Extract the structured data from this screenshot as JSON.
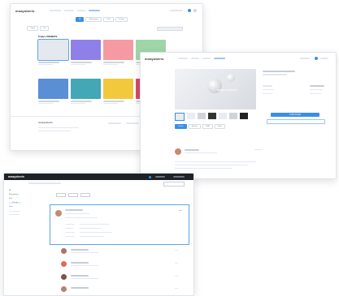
{
  "brand": {
    "logo": "moayoberis"
  },
  "win1": {
    "tabs": [
      "All",
      "Marketplace",
      "Kids",
      "Vintage"
    ],
    "filters": [
      "Latest",
      "List"
    ],
    "section_title": "Today's PROMOTE",
    "footer_logo": "moayoberis",
    "cards": [
      {
        "color": "#e4e9ef",
        "selected": true
      },
      {
        "color": "#8f7fe8"
      },
      {
        "color": "#f59aa2"
      },
      {
        "color": "#9ed6a8"
      },
      {
        "color": "#5a8fd6"
      },
      {
        "color": "#44a7b5"
      },
      {
        "color": "#f2c93c"
      },
      {
        "color": "#d44b6a"
      }
    ]
  },
  "win2": {
    "logo": "moayoberis",
    "product_title": "MONTHLY CHECKLIST",
    "buy_label": "PURCHASE",
    "tabs": [
      "Details",
      "Review",
      "Q&A",
      "Other"
    ]
  },
  "win3": {
    "logo": "moayoberis",
    "sidebar": [
      "All",
      "Marketplace",
      "Kids",
      "Vintage",
      "Free"
    ]
  },
  "colors": {
    "accent": "#3a8ee6",
    "highlight": "#5aa7e8",
    "dark_header": "#1e2226"
  }
}
